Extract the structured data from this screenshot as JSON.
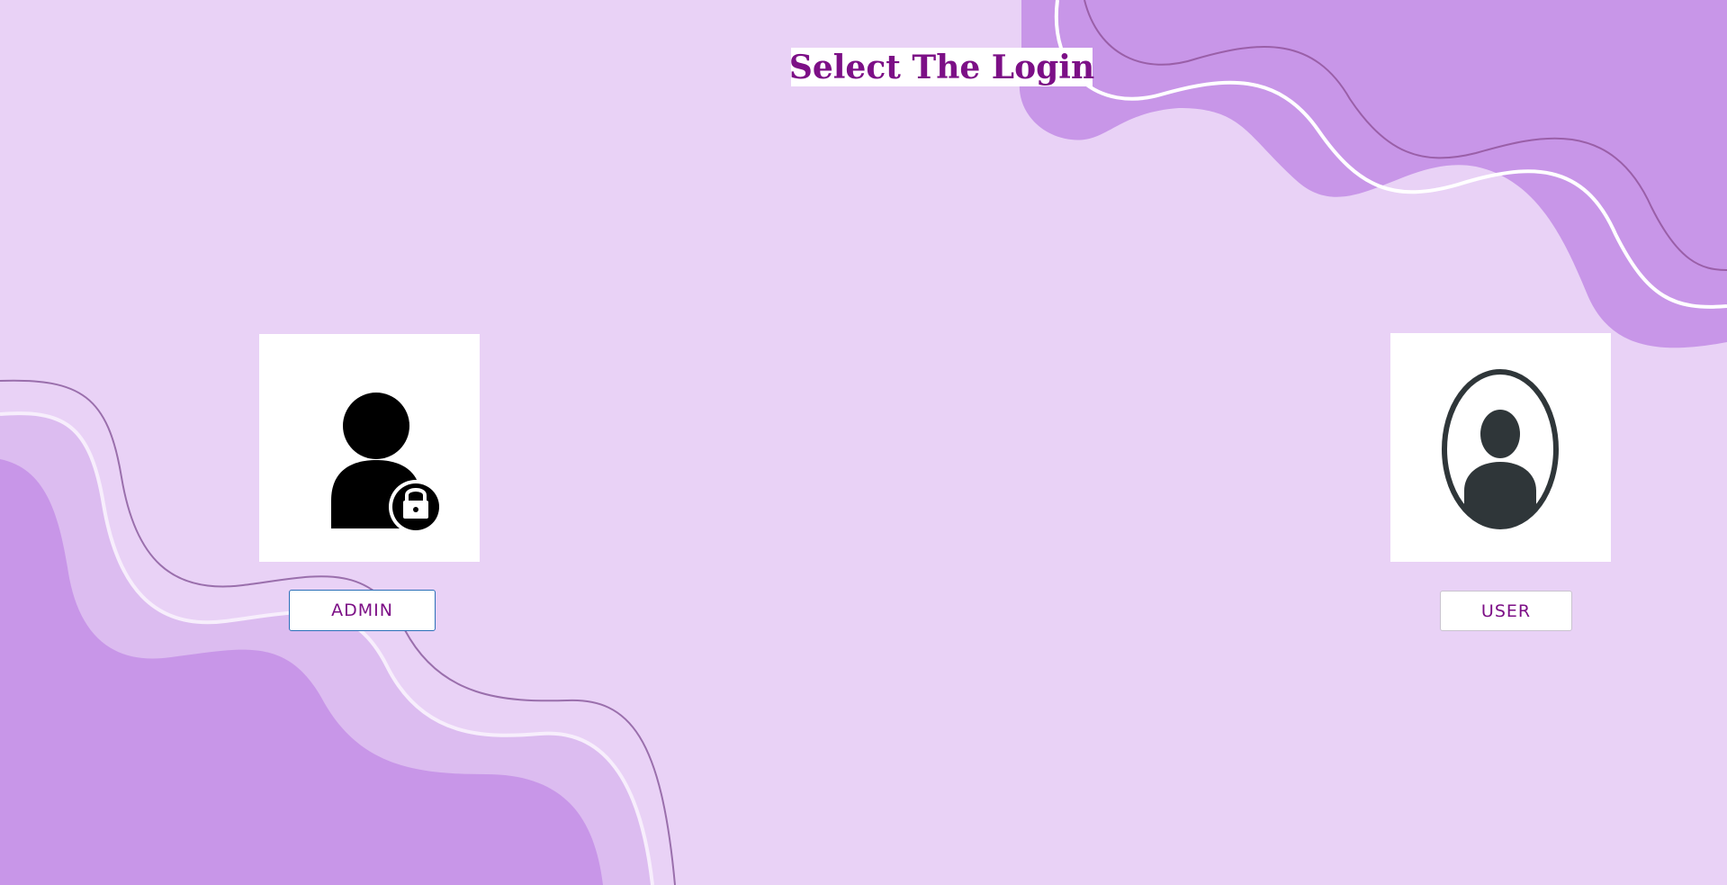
{
  "page": {
    "title": "Select The Login",
    "background_color": "#e9d2f6",
    "wave_color": "#c896e8",
    "title_color": "#7c0f86"
  },
  "options": [
    {
      "id": "admin",
      "icon": "admin-lock-icon",
      "button_label": "ADMIN"
    },
    {
      "id": "user",
      "icon": "user-avatar-icon",
      "button_label": "USER"
    }
  ]
}
